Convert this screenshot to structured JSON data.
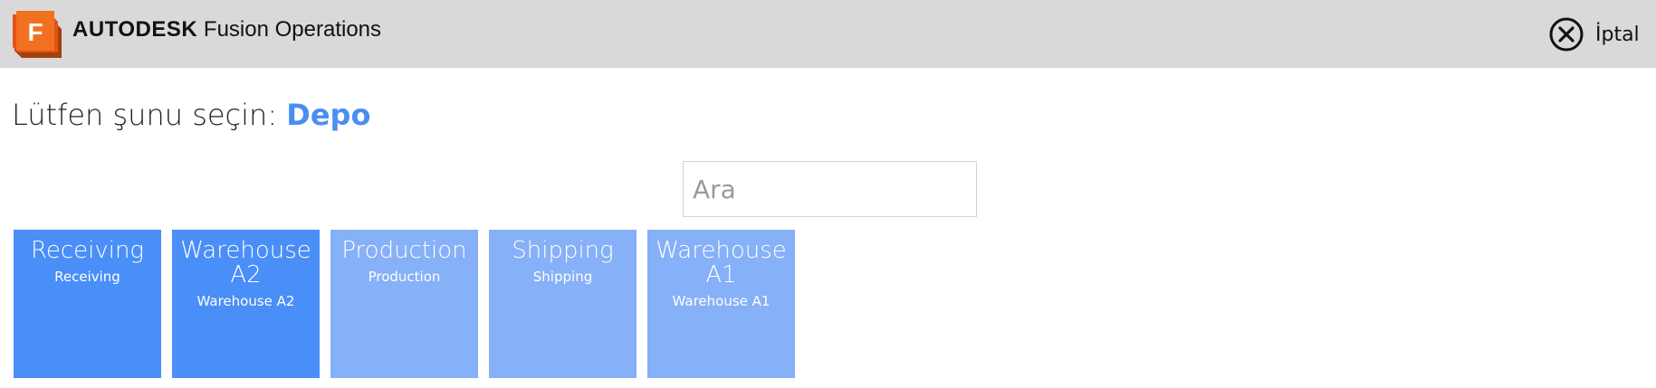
{
  "header": {
    "brand_bold": "AUTODESK",
    "brand_rest": "Fusion Operations",
    "logo_letter": "F",
    "cancel_label": "İptal",
    "bar_color": "#d9d9d9",
    "logo_color": "#f36f21"
  },
  "prompt": {
    "text": "Lütfen şunu seçin:",
    "value": "Depo",
    "value_color": "#4a8ef2"
  },
  "search": {
    "placeholder": "Ara",
    "value": ""
  },
  "tiles": [
    {
      "title": "Receiving",
      "subtitle": "Receiving",
      "state": "active",
      "color": "#4a8ef7"
    },
    {
      "title": "Warehouse A2",
      "subtitle": "Warehouse A2",
      "state": "active",
      "color": "#4a8ef7"
    },
    {
      "title": "Production",
      "subtitle": "Production",
      "state": "inactive",
      "color": "#86b0f7"
    },
    {
      "title": "Shipping",
      "subtitle": "Shipping",
      "state": "inactive",
      "color": "#86b0f7"
    },
    {
      "title": "Warehouse A1",
      "subtitle": "Warehouse A1",
      "state": "inactive",
      "color": "#86b0f7"
    }
  ],
  "icons": {
    "logo": "fusion-logo-icon",
    "cancel": "close-circle-icon"
  }
}
